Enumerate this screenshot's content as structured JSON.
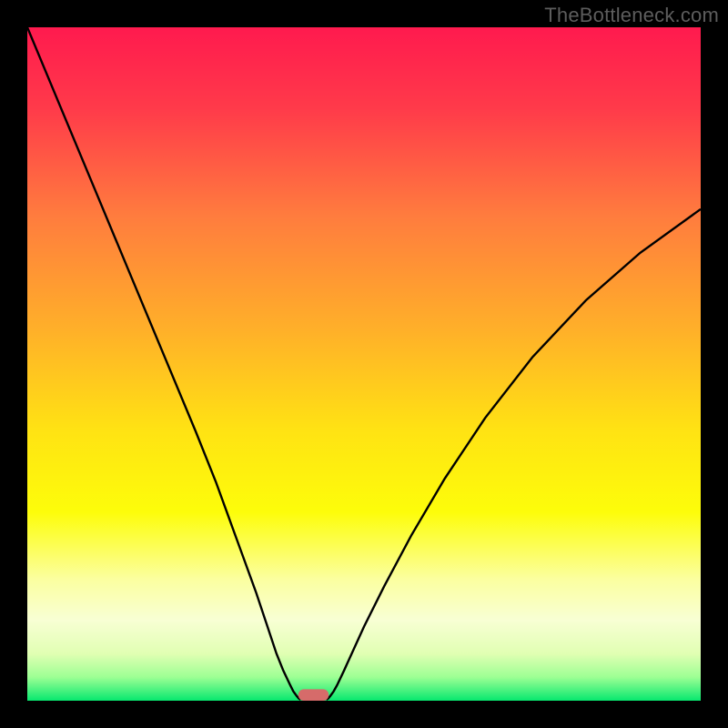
{
  "watermark": "TheBottleneck.com",
  "chart_data": {
    "type": "line",
    "title": "",
    "xlabel": "",
    "ylabel": "",
    "xlim": [
      0,
      100
    ],
    "ylim": [
      0,
      100
    ],
    "grid": false,
    "legend": false,
    "background_gradient": {
      "stops": [
        {
          "offset": 0.0,
          "color": "#ff1a4e"
        },
        {
          "offset": 0.12,
          "color": "#ff3a4a"
        },
        {
          "offset": 0.28,
          "color": "#ff7c3e"
        },
        {
          "offset": 0.45,
          "color": "#ffb029"
        },
        {
          "offset": 0.6,
          "color": "#ffe313"
        },
        {
          "offset": 0.72,
          "color": "#fdfd0a"
        },
        {
          "offset": 0.82,
          "color": "#fbffa0"
        },
        {
          "offset": 0.88,
          "color": "#f8ffd4"
        },
        {
          "offset": 0.93,
          "color": "#e1ffb3"
        },
        {
          "offset": 0.965,
          "color": "#9dff94"
        },
        {
          "offset": 1.0,
          "color": "#07e86f"
        }
      ]
    },
    "series": [
      {
        "name": "curve",
        "x": [
          0.0,
          5.0,
          10.0,
          15.0,
          20.0,
          25.0,
          28.0,
          30.0,
          32.0,
          34.0,
          35.5,
          37.0,
          38.0,
          39.0,
          39.5,
          40.0,
          40.3,
          40.6
        ],
        "y": [
          100.0,
          88.0,
          76.0,
          64.0,
          52.0,
          40.0,
          32.5,
          27.0,
          21.5,
          16.0,
          11.5,
          7.0,
          4.5,
          2.4,
          1.4,
          0.7,
          0.35,
          0.15
        ]
      },
      {
        "name": "curve-right",
        "x": [
          44.4,
          44.7,
          45.0,
          45.5,
          46.0,
          47.0,
          48.0,
          50.0,
          53.0,
          57.0,
          62.0,
          68.0,
          75.0,
          83.0,
          91.0,
          100.0
        ],
        "y": [
          0.15,
          0.35,
          0.7,
          1.4,
          2.3,
          4.4,
          6.6,
          11.0,
          17.0,
          24.5,
          33.0,
          42.0,
          51.0,
          59.5,
          66.5,
          73.0
        ]
      }
    ],
    "marker": {
      "name": "bottleneck-marker",
      "x_center": 42.5,
      "width": 4.5,
      "y": 0.0,
      "height": 1.7,
      "fill": "#d66b6a"
    }
  }
}
